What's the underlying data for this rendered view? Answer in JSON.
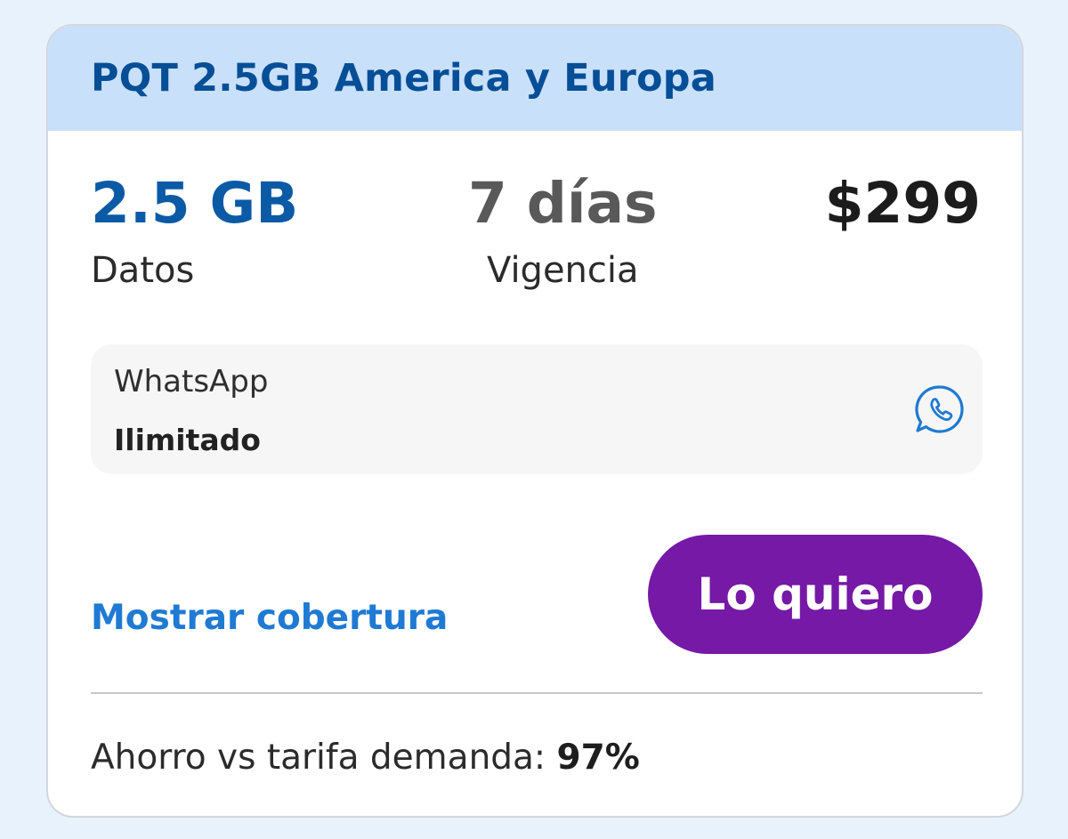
{
  "plan": {
    "title": "PQT 2.5GB America y Europa",
    "data_value": "2.5 GB",
    "data_label": "Datos",
    "validity_value": "7 días",
    "validity_label": "Vigencia",
    "price": "$299"
  },
  "benefit": {
    "name": "WhatsApp",
    "value": "Ilimitado",
    "icon": "whatsapp-icon"
  },
  "actions": {
    "coverage_link": "Mostrar cobertura",
    "buy_button": "Lo quiero"
  },
  "savings": {
    "label": "Ahorro vs tarifa demanda:",
    "percent": "97%"
  },
  "colors": {
    "header_bg": "#c9e0fb",
    "title": "#064f97",
    "data_value": "#0b5aa6",
    "link": "#1f7ad3",
    "button": "#7519a6",
    "page_bg": "#e8f2fd"
  }
}
